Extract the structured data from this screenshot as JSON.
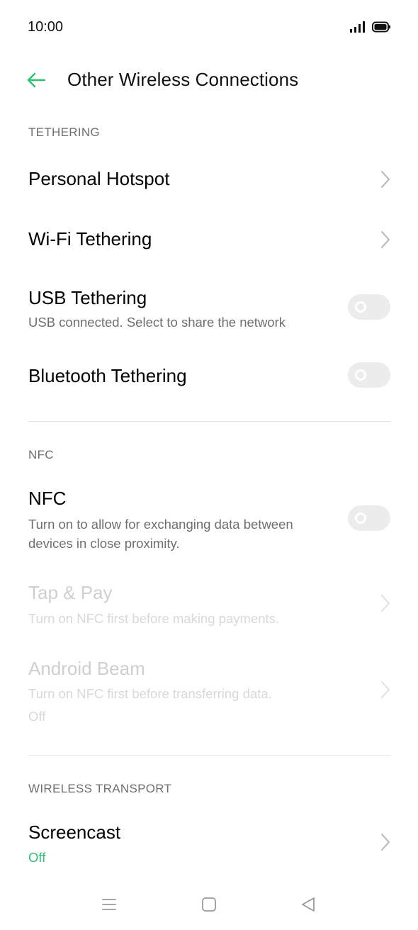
{
  "status_bar": {
    "time": "10:00"
  },
  "header": {
    "title": "Other Wireless Connections"
  },
  "sections": {
    "tethering": {
      "label": "TETHERING"
    },
    "nfc": {
      "label": "NFC"
    },
    "wireless_transport": {
      "label": "WIRELESS TRANSPORT"
    }
  },
  "rows": {
    "personal_hotspot": {
      "title": "Personal Hotspot"
    },
    "wifi_tethering": {
      "title": "Wi-Fi Tethering"
    },
    "usb_tethering": {
      "title": "USB Tethering",
      "subtitle": "USB connected. Select to share the network",
      "enabled": false
    },
    "bluetooth_tethering": {
      "title": "Bluetooth Tethering",
      "enabled": false
    },
    "nfc": {
      "title": "NFC",
      "subtitle": "Turn on to allow for exchanging data between devices in close proximity.",
      "enabled": false
    },
    "tap_pay": {
      "title": "Tap & Pay",
      "subtitle": "Turn on NFC first before making payments."
    },
    "android_beam": {
      "title": "Android Beam",
      "subtitle": "Turn on NFC first before transferring data.",
      "value": "Off"
    },
    "screencast": {
      "title": "Screencast",
      "value": "Off"
    }
  },
  "colors": {
    "accent": "#2fbf71",
    "toggle_off": "#ececec",
    "secondary_text": "#6f6f6f",
    "disabled_text": "#cfcfcf"
  },
  "icons": {
    "back": "arrow-left-icon",
    "chevron": "chevron-right-icon",
    "signal": "signal-icon",
    "battery": "battery-icon",
    "nav_menu": "menu-icon",
    "nav_home": "home-icon",
    "nav_back": "back-triangle-icon"
  }
}
